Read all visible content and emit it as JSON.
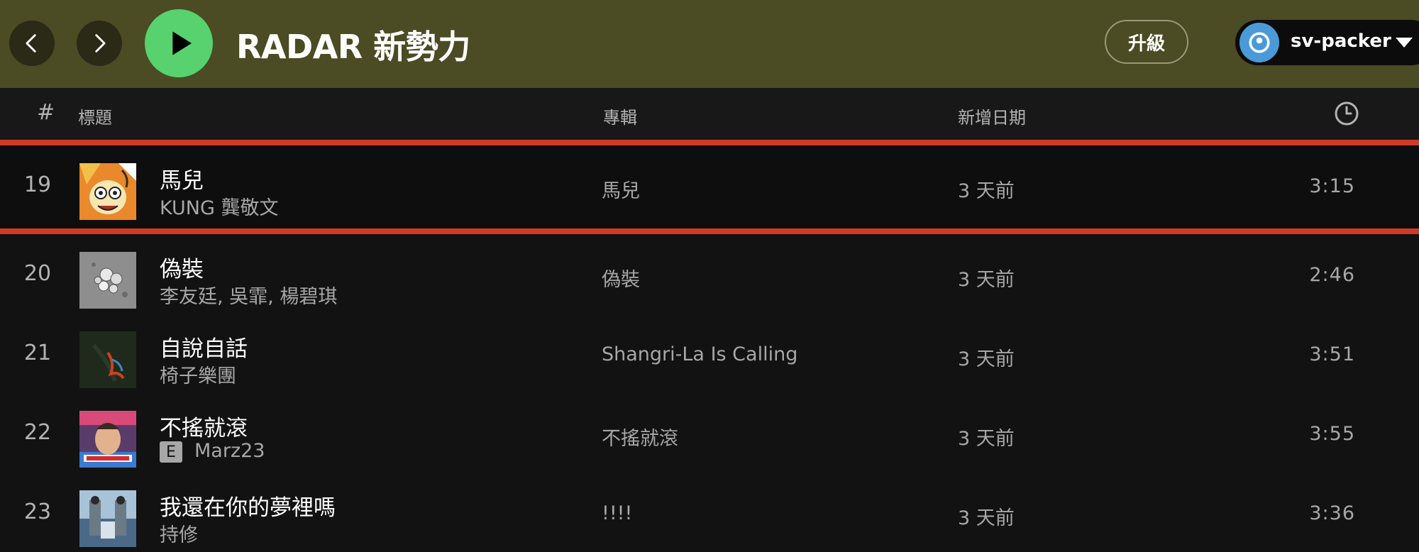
{
  "header": {
    "title": "RADAR 新勢力",
    "upgrade_label": "升級",
    "username": "sv-packer"
  },
  "columns": {
    "number": "#",
    "title": "標題",
    "album": "專輯",
    "date_added": "新增日期"
  },
  "colors": {
    "topbar": "#4b4b24",
    "play_button": "#57d26e",
    "highlight_line": "#d03a26",
    "avatar": "#4a9ad8"
  },
  "icons": {
    "back": "chevron-left-icon",
    "forward": "chevron-right-icon",
    "play": "play-icon",
    "user": "user-avatar-icon",
    "dropdown": "caret-down-icon",
    "duration": "clock-icon"
  },
  "tracks": [
    {
      "number": "19",
      "title": "馬兒",
      "artist": "KUNG 龔敬文",
      "explicit": false,
      "album": "馬兒",
      "date_added": "3 天前",
      "duration": "3:15",
      "highlighted": true
    },
    {
      "number": "20",
      "title": "偽裝",
      "artist": "李友廷, 吳霏, 楊碧琪",
      "explicit": false,
      "album": "偽裝",
      "date_added": "3 天前",
      "duration": "2:46",
      "highlighted": false
    },
    {
      "number": "21",
      "title": "自說自話",
      "artist": "椅子樂團",
      "explicit": false,
      "album": "Shangri-La Is Calling",
      "date_added": "3 天前",
      "duration": "3:51",
      "highlighted": false
    },
    {
      "number": "22",
      "title": "不搖就滾",
      "artist": "Marz23",
      "explicit": true,
      "explicit_label": "E",
      "album": "不搖就滾",
      "date_added": "3 天前",
      "duration": "3:55",
      "highlighted": false
    },
    {
      "number": "23",
      "title": "我還在你的夢裡嗎",
      "artist": "持修",
      "explicit": false,
      "album": "!!!!",
      "date_added": "3 天前",
      "duration": "3:36",
      "highlighted": false
    }
  ]
}
